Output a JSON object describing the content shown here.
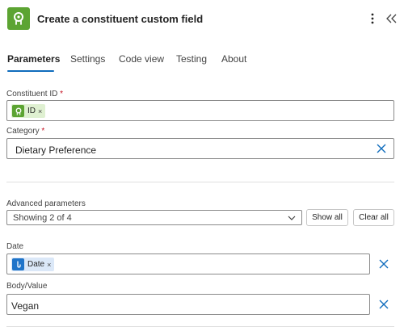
{
  "header": {
    "title": "Create a constituent custom field",
    "app_icon": "blackbaud-connector-icon",
    "more_icon": "more-vertical-icon",
    "collapse_icon": "double-chevron-left-icon"
  },
  "tabs": [
    {
      "label": "Parameters",
      "active": true
    },
    {
      "label": "Settings",
      "active": false
    },
    {
      "label": "Code view",
      "active": false
    },
    {
      "label": "Testing",
      "active": false
    },
    {
      "label": "About",
      "active": false
    }
  ],
  "fields": {
    "constituent_id": {
      "label": "Constituent ID",
      "required_mark": "*",
      "token": "ID",
      "token_remove": "×"
    },
    "category": {
      "label": "Category",
      "required_mark": "*",
      "value": "Dietary Preference"
    },
    "date": {
      "label": "Date",
      "token": "Date",
      "token_remove": "×"
    },
    "body_value": {
      "label": "Body/Value",
      "value": "Vegan"
    }
  },
  "advanced": {
    "label": "Advanced parameters",
    "selected": "Showing 2 of 4",
    "show_all": "Show all",
    "clear_all": "Clear all"
  },
  "colors": {
    "accent": "#0f6cbd",
    "app_green": "#5ca432",
    "token_green_bg": "#dff0d1",
    "token_blue_bg": "#dbe8f8",
    "token_blue_icon": "#1f74c9",
    "required": "#c50f1f"
  }
}
